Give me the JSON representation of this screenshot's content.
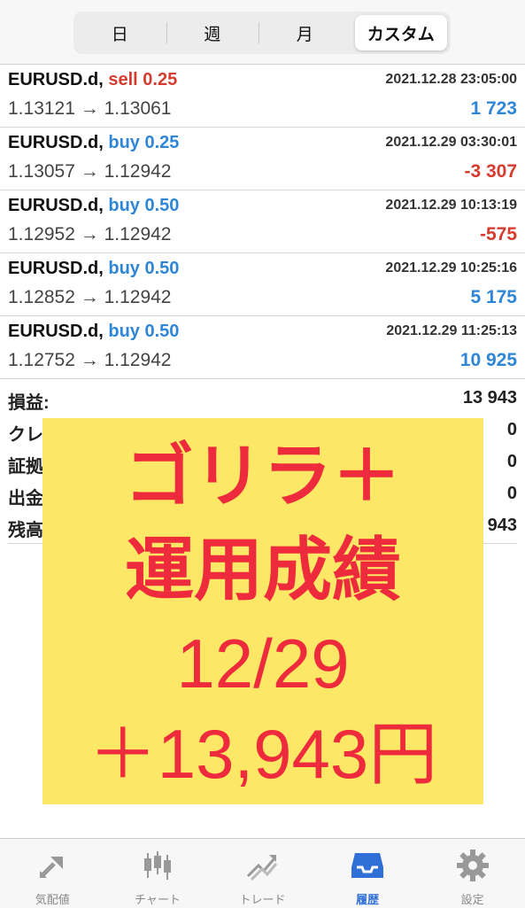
{
  "period_tabs": [
    "日",
    "週",
    "月",
    "カスタム"
  ],
  "active_period": "カスタム",
  "deals": [
    {
      "symbol": "EURUSD.d,",
      "side": "sell 0.25",
      "type": "sell",
      "time": "2021.12.28 23:05:00",
      "prices": "1.13121 → 1.13061",
      "profit": "1 723",
      "sign": "pos"
    },
    {
      "symbol": "EURUSD.d,",
      "side": "buy 0.25",
      "type": "buy",
      "time": "2021.12.29 03:30:01",
      "prices": "1.13057 → 1.12942",
      "profit": "-3 307",
      "sign": "neg"
    },
    {
      "symbol": "EURUSD.d,",
      "side": "buy 0.50",
      "type": "buy",
      "time": "2021.12.29 10:13:19",
      "prices": "1.12952 → 1.12942",
      "profit": "-575",
      "sign": "neg"
    },
    {
      "symbol": "EURUSD.d,",
      "side": "buy 0.50",
      "type": "buy",
      "time": "2021.12.29 10:25:16",
      "prices": "1.12852 → 1.12942",
      "profit": "5 175",
      "sign": "pos"
    },
    {
      "symbol": "EURUSD.d,",
      "side": "buy 0.50",
      "type": "buy",
      "time": "2021.12.29 11:25:13",
      "prices": "1.12752 → 1.12942",
      "profit": "10 925",
      "sign": "pos"
    }
  ],
  "summary": {
    "profit_label": "損益:",
    "profit_value": "13 943",
    "credit_label": "クレ",
    "credit_value": "0",
    "deposit_label": "証拠",
    "deposit_value": "0",
    "withdraw_label": "出金",
    "withdraw_value": "0",
    "balance_label": "残高",
    "balance_value": "943"
  },
  "banner": {
    "line1": "ゴリラ＋",
    "line2": "運用成績",
    "line3": "12/29",
    "line4": "＋13,943円"
  },
  "tabbar": {
    "items": [
      "気配値",
      "チャート",
      "トレード",
      "履歴",
      "設定"
    ],
    "active": "履歴"
  },
  "colors": {
    "sell": "#d63b2f",
    "buy": "#2f86d6",
    "banner_bg": "#fce866",
    "banner_text": "#ee2b3c",
    "accent": "#2f6fd6"
  }
}
